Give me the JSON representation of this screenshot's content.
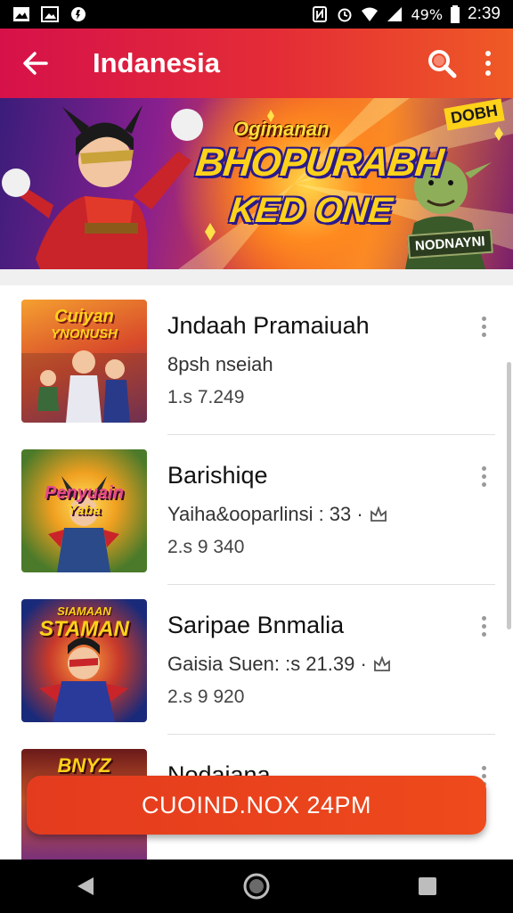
{
  "status_bar": {
    "battery_text": "49%",
    "time": "2:39",
    "left_icons": [
      "photo-icon",
      "gallery-icon",
      "app-icon"
    ],
    "right_icons": [
      "nfc-icon",
      "alarm-icon",
      "wifi-icon",
      "signal-icon",
      "battery-icon"
    ]
  },
  "app_bar": {
    "title": "Indanesia",
    "back_icon": "arrow-left-icon",
    "search_icon": "search-icon",
    "more_icon": "more-vertical-icon"
  },
  "banner": {
    "small_text": "Ogimanan",
    "main_text": "BHOPURABH",
    "sub_text": "KED ONE",
    "corner_text": "DOBH",
    "tag_text": "NODNAYNI"
  },
  "list": {
    "items": [
      {
        "title": "Jndaah Pramaiuah",
        "subtitle": "8psh nseiah",
        "meta": "1.s 7.249",
        "thumb_text_top": "Cuiyan",
        "thumb_text_bottom": "YNONUSH",
        "has_badge": false
      },
      {
        "title": "Barishiqe",
        "subtitle": "Yaiha&ooparlinsi : 33 ·",
        "meta": "2.s 9 340",
        "thumb_text_top": "Penyuain",
        "thumb_text_bottom": "Yaba",
        "has_badge": true
      },
      {
        "title": "Saripae Bnmalia",
        "subtitle": "Gaisia Suen: :s 21.39 ·",
        "meta": "2.s 9 920",
        "thumb_text_top": "SIAMAAN",
        "thumb_text_bottom": "STAMAN",
        "has_badge": true
      },
      {
        "title": "Nodaiana",
        "subtitle": "",
        "meta": "",
        "thumb_text_top": "BNYZ",
        "thumb_text_bottom": "",
        "has_badge": false
      }
    ]
  },
  "cta": {
    "label": "CUOIND.NOX 24PM"
  },
  "nav_bar": {
    "icons": [
      "back-triangle-icon",
      "home-circle-icon",
      "recents-square-icon"
    ]
  },
  "colors": {
    "app_bar_start": "#d6114a",
    "app_bar_end": "#ef5a25",
    "cta": "#e8401d",
    "text_primary": "#111111",
    "text_secondary": "#444444"
  }
}
